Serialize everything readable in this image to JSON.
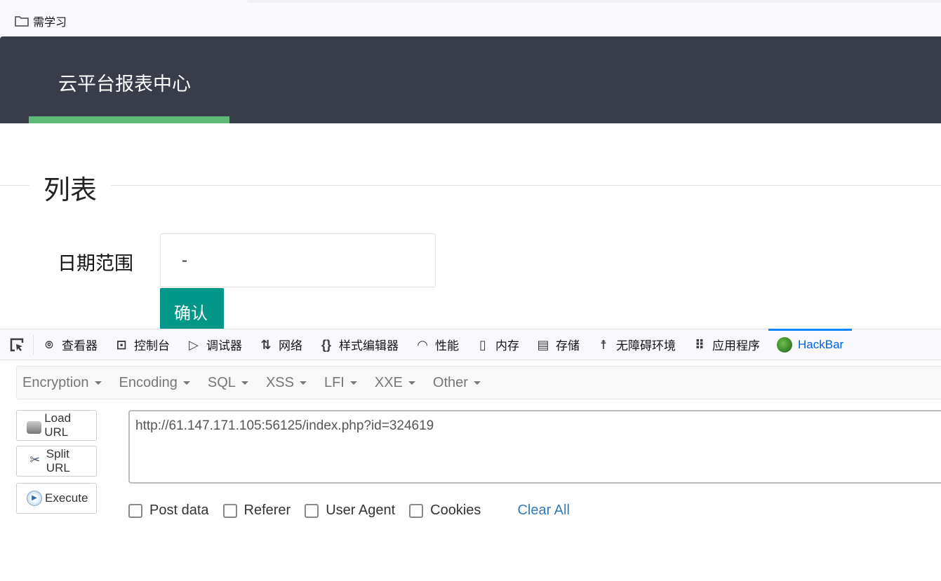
{
  "bookmarks": {
    "items": [
      {
        "label": "需学习",
        "icon": "folder-icon"
      }
    ]
  },
  "header": {
    "title": "云平台报表中心",
    "accent": "#5fb878",
    "background": "#393d49"
  },
  "section": {
    "title": "列表"
  },
  "form": {
    "date_label": "日期范围",
    "date_value": "-",
    "confirm_label": "确认",
    "confirm_color": "#009688"
  },
  "devtools": {
    "tabs": [
      {
        "label": "查看器",
        "icon": "inspector-icon"
      },
      {
        "label": "控制台",
        "icon": "console-icon"
      },
      {
        "label": "调试器",
        "icon": "debugger-icon"
      },
      {
        "label": "网络",
        "icon": "network-icon"
      },
      {
        "label": "样式编辑器",
        "icon": "style-editor-icon"
      },
      {
        "label": "性能",
        "icon": "performance-icon"
      },
      {
        "label": "内存",
        "icon": "memory-icon"
      },
      {
        "label": "存储",
        "icon": "storage-icon"
      },
      {
        "label": "无障碍环境",
        "icon": "accessibility-icon"
      },
      {
        "label": "应用程序",
        "icon": "application-icon"
      },
      {
        "label": "HackBar",
        "icon": "hackbar-icon",
        "active": true
      }
    ]
  },
  "hackbar": {
    "menus": [
      "Encryption",
      "Encoding",
      "SQL",
      "XSS",
      "LFI",
      "XXE",
      "Other"
    ],
    "buttons": [
      "Load URL",
      "Split URL",
      "Execute"
    ],
    "url": "http://61.147.171.105:56125/index.php?id=324619",
    "options": [
      "Post data",
      "Referer",
      "User Agent",
      "Cookies"
    ],
    "clear_all": "Clear All"
  }
}
